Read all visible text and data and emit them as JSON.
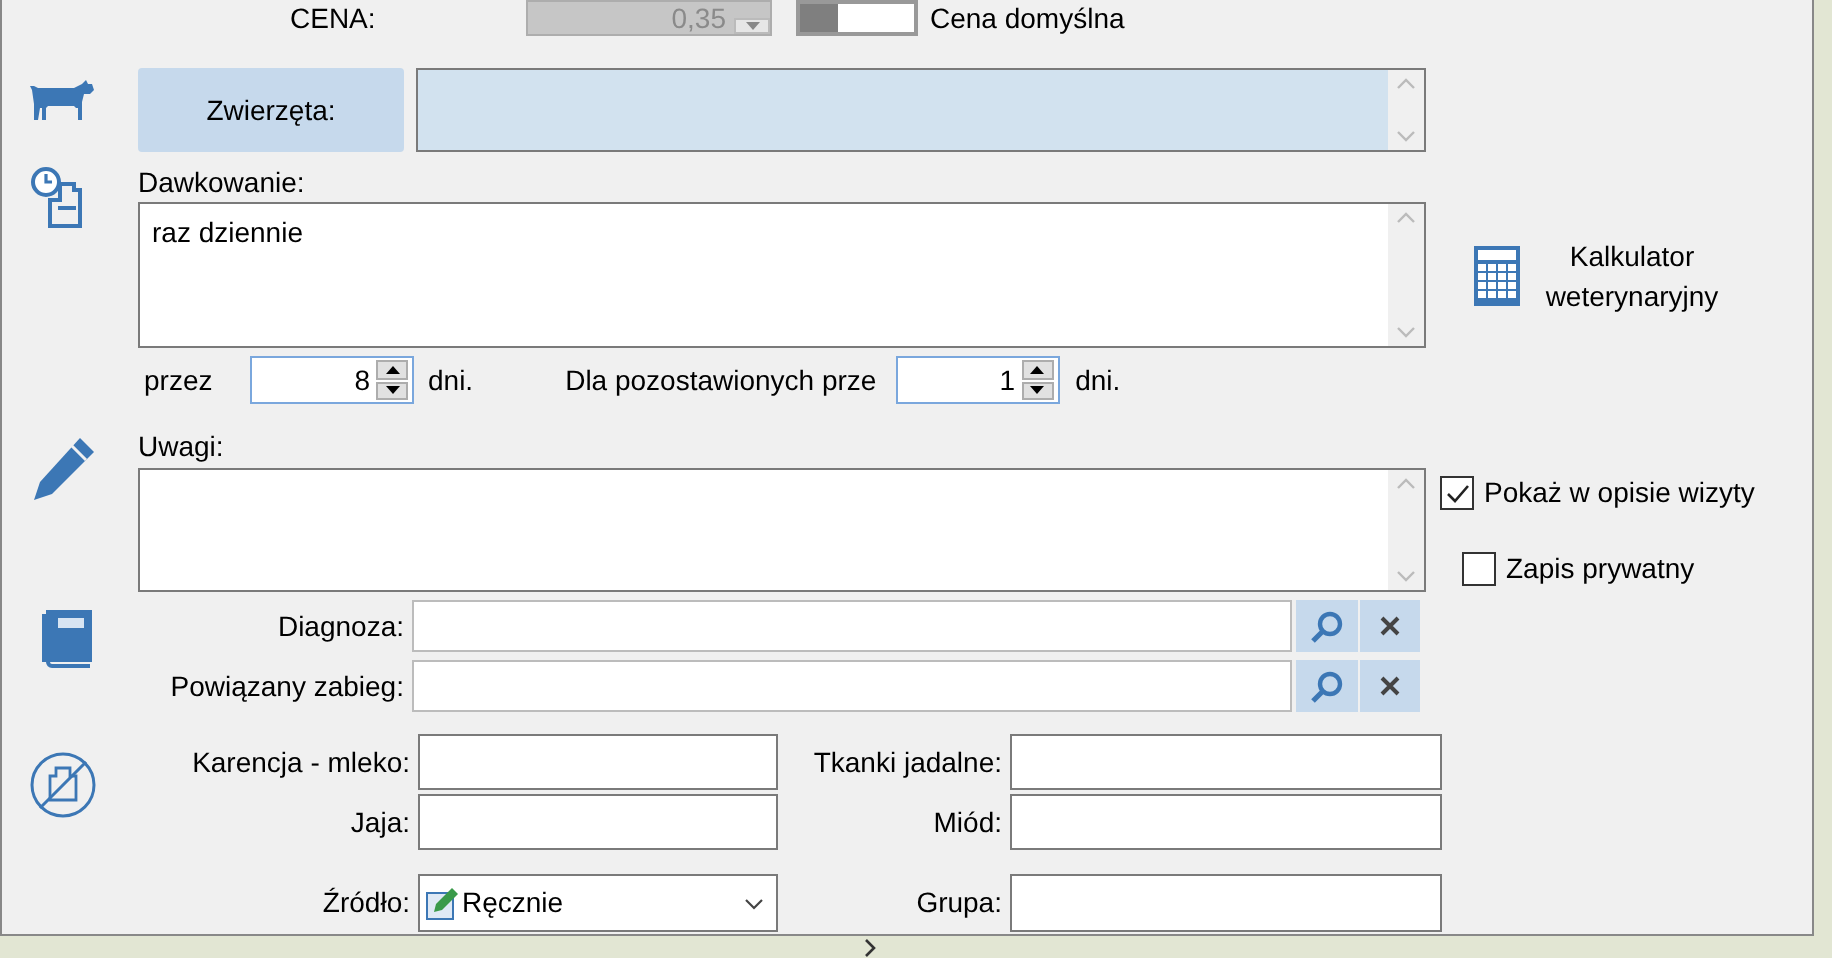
{
  "price": {
    "label": "CENA:",
    "value": "0,35",
    "disabled": true
  },
  "default_price": {
    "label": "Cena domyślna"
  },
  "animals": {
    "button": "Zwierzęta:"
  },
  "dosage": {
    "label": "Dawkowanie:",
    "value": "raz dziennie"
  },
  "calculator": {
    "label": "Kalkulator weterynaryjny"
  },
  "duration": {
    "prefix": "przez",
    "value": "8",
    "unit": "dni."
  },
  "remaining": {
    "label": "Dla pozostawionych prze",
    "value": "1",
    "unit": "dni."
  },
  "notes": {
    "label": "Uwagi:"
  },
  "options": [
    {
      "label": "Pokaż w opisie wizyty",
      "checked": true
    },
    {
      "label": "Zapis prywatny",
      "checked": false
    }
  ],
  "lookups": [
    {
      "label": "Diagnoza:"
    },
    {
      "label": "Powiązany zabieg:"
    }
  ],
  "withdrawal": [
    {
      "label": "Karencja - mleko:"
    },
    {
      "label": "Tkanki jadalne:"
    },
    {
      "label": "Jaja:"
    },
    {
      "label": "Miód:"
    }
  ],
  "source": {
    "label": "Źródło:",
    "value": "Ręcznie"
  },
  "group": {
    "label": "Grupa:"
  }
}
